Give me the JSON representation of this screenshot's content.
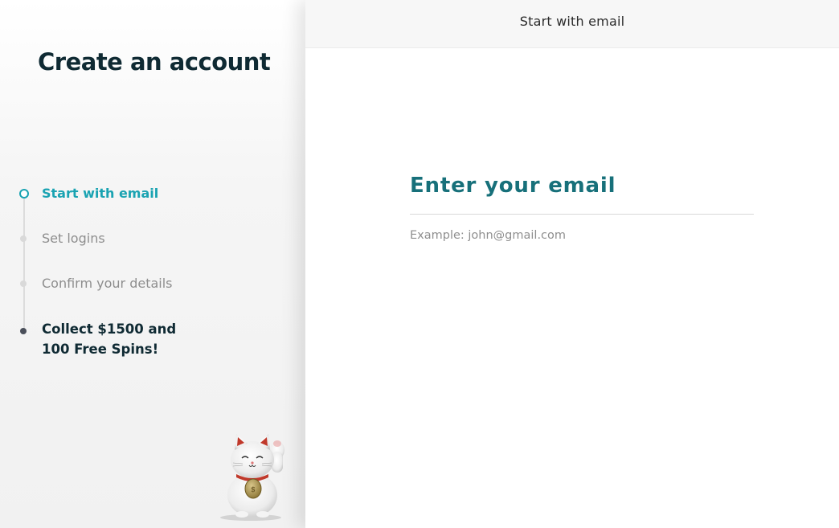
{
  "sidebar": {
    "title": "Create an account",
    "steps": [
      {
        "label": "Start with email",
        "state": "active"
      },
      {
        "label": "Set logins",
        "state": "pending"
      },
      {
        "label": "Confirm your details",
        "state": "pending"
      },
      {
        "label": "Collect $1500 and 100 Free Spins!",
        "state": "final"
      }
    ],
    "illustration": "lucky-cat"
  },
  "main": {
    "header_title": "Start with email",
    "form": {
      "heading": "Enter your email",
      "email_value": "",
      "email_hint": "Example: john@gmail.com"
    }
  },
  "colors": {
    "accent": "#1aa3b2",
    "heading_teal": "#17707a",
    "title_dark": "#0f2a33",
    "muted": "#8e8e8e"
  }
}
